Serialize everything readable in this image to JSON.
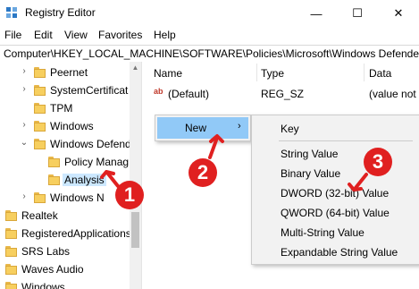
{
  "window": {
    "title": "Registry Editor",
    "minimize": "—",
    "maximize": "☐",
    "close": "✕"
  },
  "menu": [
    "File",
    "Edit",
    "View",
    "Favorites",
    "Help"
  ],
  "address": "Computer\\HKEY_LOCAL_MACHINE\\SOFTWARE\\Policies\\Microsoft\\Windows Defender\\",
  "tree": [
    {
      "label": "Peernet",
      "expander": "›"
    },
    {
      "label": "SystemCertificat",
      "expander": "›"
    },
    {
      "label": "TPM",
      "expander": ""
    },
    {
      "label": "Windows",
      "expander": "›"
    },
    {
      "label": "Windows Defend",
      "expander": "⌄"
    },
    {
      "label": "Policy Manag",
      "expander": ""
    },
    {
      "label": "Analysis",
      "expander": ""
    },
    {
      "label": "Windows N",
      "expander": "›"
    },
    {
      "label": "Realtek",
      "expander": "›"
    },
    {
      "label": "RegisteredApplications",
      "expander": ""
    },
    {
      "label": "SRS Labs",
      "expander": "›"
    },
    {
      "label": "Waves Audio",
      "expander": "›"
    },
    {
      "label": "Windows",
      "expander": "›"
    }
  ],
  "columns": {
    "name": "Name",
    "type": "Type",
    "data": "Data"
  },
  "values": [
    {
      "icon": "ab",
      "name": "(Default)",
      "type": "REG_SZ",
      "data": "(value not"
    }
  ],
  "context_menu": {
    "new_label": "New",
    "arrow": "›"
  },
  "submenu": [
    "Key",
    "String Value",
    "Binary Value",
    "DWORD (32-bit) Value",
    "QWORD (64-bit) Value",
    "Multi-String Value",
    "Expandable String Value"
  ],
  "steps": [
    "1",
    "2",
    "3"
  ],
  "colors": {
    "accent_highlight": "#91c9f7",
    "folder": "#f7cf5f",
    "annotation": "#e02020",
    "selection": "#cce8ff"
  }
}
